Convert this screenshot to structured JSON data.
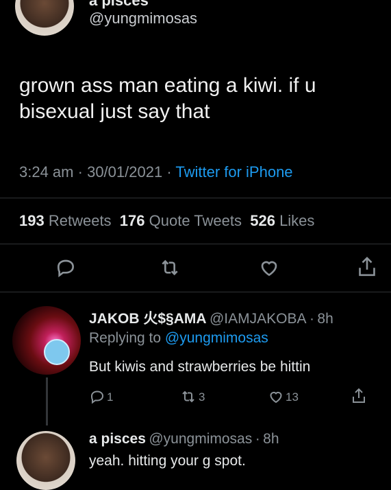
{
  "main_tweet": {
    "author_name": "a pisces",
    "handle": "@yungmimosas",
    "text": "grown ass man eating a kiwi. if u bisexual just say that",
    "time": "3:24 am",
    "date": "30/01/2021",
    "source": "Twitter for iPhone",
    "stats": {
      "retweets_count": "193",
      "retweets_label": "Retweets",
      "quotes_count": "176",
      "quotes_label": "Quote Tweets",
      "likes_count": "526",
      "likes_label": "Likes"
    },
    "actions": [
      "reply-icon",
      "retweet-icon",
      "like-icon",
      "share-icon"
    ]
  },
  "replies": [
    {
      "name": "JAKOB 火$§AMA",
      "handle": "@IAMJAKOBA",
      "time": "8h",
      "replying_label": "Replying to",
      "replying_to": "@yungmimosas",
      "text": "But kiwis and strawberries be hittin",
      "reply_count": "1",
      "retweet_count": "3",
      "like_count": "13"
    },
    {
      "name": "a pisces",
      "handle": "@yungmimosas",
      "time": "8h",
      "text": "yeah. hitting your g spot."
    }
  ],
  "separator": "·",
  "colors": {
    "accent": "#1d9bf0",
    "background": "#000000",
    "muted": "#8b9298"
  }
}
